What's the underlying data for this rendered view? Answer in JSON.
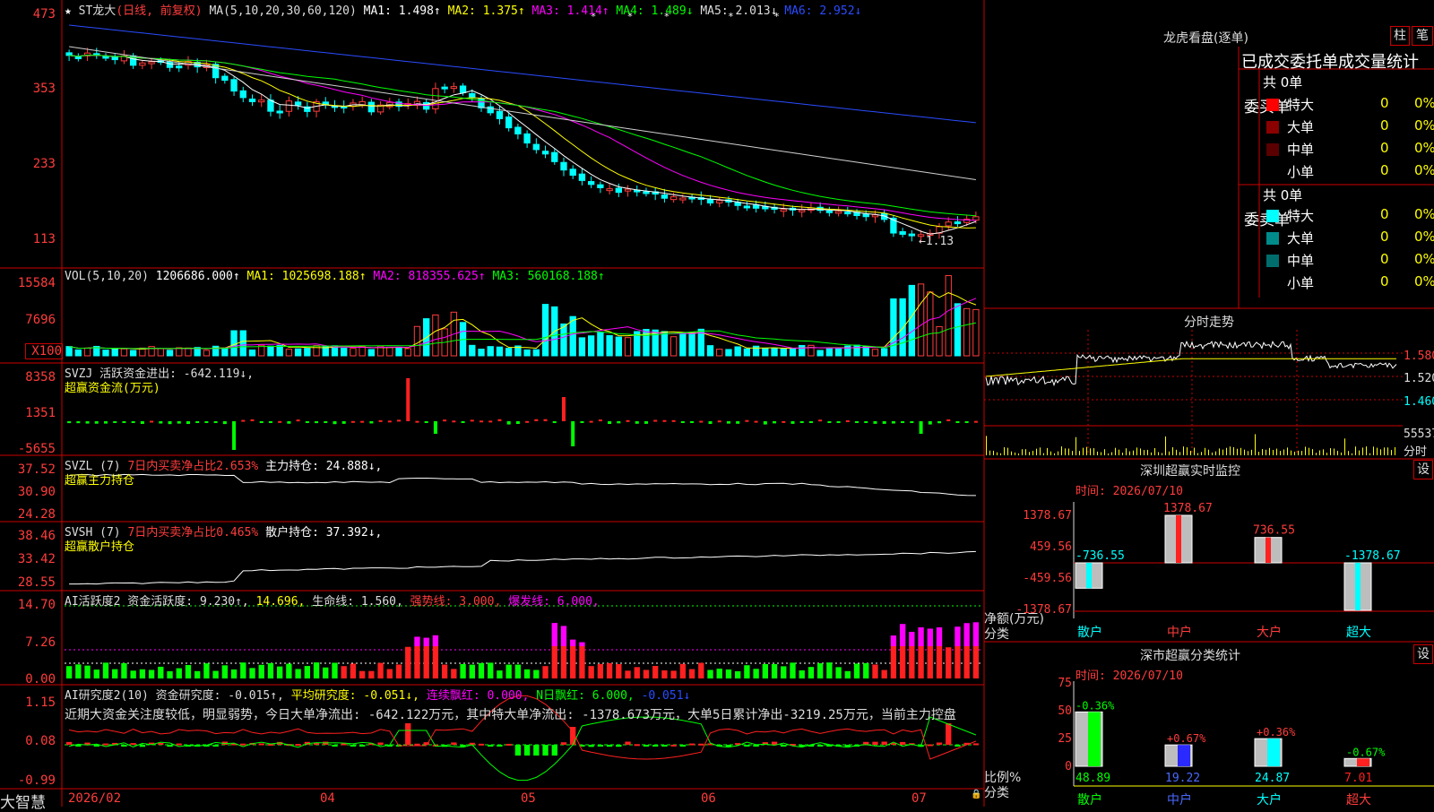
{
  "header": {
    "star": "★",
    "code": "ST龙大",
    "period": "(日线, 前复权)",
    "ma_prefix": "MA(5,10,20,30,60,120)",
    "ma1": "MA1: 1.498↑",
    "ma2": "MA2: 1.375↑",
    "ma3": "MA3: 1.414↑",
    "ma4": "MA4: 1.489↓",
    "ma5": "MA5: 2.013↓",
    "ma6": "MA6: 2.952↓"
  },
  "price_axis": [
    "473",
    "353",
    "233",
    "113"
  ],
  "price_annotation": "←1.13",
  "vol": {
    "label": "VOL(5,10,20)",
    "value": "1206686.000↑",
    "ma1": "MA1: 1025698.188↑",
    "ma2": "MA2: 818355.625↑",
    "ma3": "MA3: 560168.188↑",
    "axis": [
      "15584",
      "7696",
      "X100"
    ]
  },
  "svzj": {
    "label": "SVZJ  活跃资金进出: -642.119↓,",
    "sub": "超赢资金流(万元)",
    "axis": [
      "8358",
      "1351",
      "-5655"
    ]
  },
  "svzl": {
    "label": "SVZL (7)",
    "ratio": "7日内买卖净占比2.653%",
    "hold": "主力持仓: 24.888↓,",
    "sub": "超赢主力持仓",
    "axis": [
      "37.52",
      "30.90",
      "24.28"
    ]
  },
  "svsh": {
    "label": "SVSH (7)",
    "ratio": "7日内买卖净占比0.465%",
    "hold": "散户持仓: 37.392↓,",
    "sub": "超赢散户持仓",
    "axis": [
      "38.46",
      "33.42",
      "28.55"
    ]
  },
  "ai1": {
    "label": "AI活跃度2 资金活跃度: 9.230↑,",
    "v2": "14.696,",
    "v3": "生命线: 1.560,",
    "v4": "强势线: 3.000,",
    "v5": "爆发线: 6.000,",
    "axis": [
      "14.70",
      "7.26",
      "0.00"
    ]
  },
  "ai2": {
    "label": "AI研究度2(10) 资金研究度: -0.015↑,",
    "avg": "平均研究度: -0.051↓,",
    "red": "连续飘红: 0.000,",
    "n": "N日飘红: 6.000,",
    "last": "-0.051↓",
    "comment": "近期大资金关注度较低，明显弱势，今日大单净流出: -642.122万元，其中特大单净流出: -1378.673万元，大单5日累计净出-3219.25万元，当前主力控盘",
    "axis": [
      "1.15",
      "0.08",
      "-0.99"
    ]
  },
  "date_axis": {
    "start": "2026/02",
    "m04": "04",
    "m05": "05",
    "m06": "06",
    "m07": "07"
  },
  "brand": "大智慧",
  "lhb": {
    "title": "龙虎看盘(逐单)",
    "btn_zhu": "柱",
    "btn_bi": "笔",
    "subtitle": "已成交委托单成交量统计",
    "buy_total": "共 0单",
    "sell_total": "共 0单",
    "buy_label": "委买单",
    "sell_label": "委卖单",
    "rows": [
      {
        "name": "特大",
        "val": "0",
        "pct": "0%",
        "color": "#ff0000"
      },
      {
        "name": "大单",
        "val": "0",
        "pct": "0%",
        "color": "#8b0000"
      },
      {
        "name": "中单",
        "val": "0",
        "pct": "0%",
        "color": "#5a0000"
      },
      {
        "name": "小单",
        "val": "0",
        "pct": "0%",
        "color": "#000000"
      }
    ],
    "sell_rows": [
      {
        "name": "特大",
        "val": "0",
        "pct": "0%",
        "color": "#00ffff"
      },
      {
        "name": "大单",
        "val": "0",
        "pct": "0%",
        "color": "#008b8b"
      },
      {
        "name": "中单",
        "val": "0",
        "pct": "0%",
        "color": "#006d6d"
      },
      {
        "name": "小单",
        "val": "0",
        "pct": "0%",
        "color": "#000000"
      }
    ]
  },
  "fenshi": {
    "title": "分时走势",
    "axis": [
      "1.580",
      "1.520",
      "1.460"
    ],
    "vol_label": "55537",
    "fs_label": "分时"
  },
  "monitor": {
    "title": "深圳超赢实时监控",
    "btn": "设",
    "time": "时间: 2026/07/10",
    "axis": [
      "1378.67",
      "459.56",
      "-459.56",
      "-1378.67"
    ],
    "ylabel1": "净额(万元)",
    "ylabel2": "分类",
    "cats": [
      "散户",
      "中户",
      "大户",
      "超大"
    ],
    "values": [
      "-736.55",
      "1378.67",
      "736.55",
      "-1378.67"
    ]
  },
  "stats": {
    "title": "深市超赢分类统计",
    "btn": "设",
    "time": "时间: 2026/07/10",
    "axis": [
      "75",
      "50",
      "25",
      "0"
    ],
    "ylabel1": "比例%",
    "ylabel2": "分类",
    "cats": [
      "散户",
      "中户",
      "大户",
      "超大"
    ],
    "values": [
      "48.89",
      "19.22",
      "24.87",
      "7.01"
    ],
    "changes": [
      "-0.36%",
      "+0.67%",
      "+0.36%",
      "-0.67%"
    ]
  }
}
